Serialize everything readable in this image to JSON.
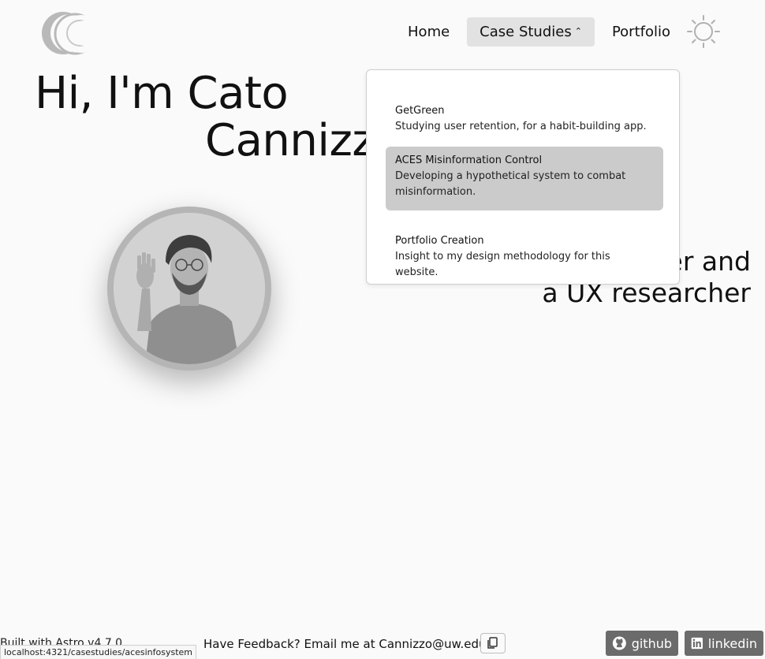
{
  "nav": {
    "home": "Home",
    "case_studies": "Case Studies",
    "case_studies_caret": "^",
    "portfolio": "Portfolio"
  },
  "hero": {
    "line1": "Hi, I'm Cato",
    "line2": "Cannizz",
    "tagline_line1": "er and",
    "tagline_line2": "a UX researcher"
  },
  "dropdown": {
    "items": [
      {
        "title": "GetGreen",
        "description": "Studying user retention, for a habit-building app."
      },
      {
        "title": "ACES Misinformation Control",
        "description": "Developing a hypothetical system to combat misinformation."
      },
      {
        "title": "Portfolio Creation",
        "description": "Insight to my design methodology for this website."
      }
    ]
  },
  "footer": {
    "built_with": "Built with Astro v4.7.0",
    "feedback": "Have Feedback? Email me at Cannizzo@uw.edu",
    "github": "github",
    "linkedin": "linkedin"
  },
  "status_bar": {
    "url": "localhost:4321/casestudies/acesinfosystem"
  },
  "colors": {
    "background": "#fafafa",
    "nav_active": "#e2e2e2",
    "dropdown_hover": "#cbcbcb",
    "social_button": "#6b6b6b"
  },
  "icons": {
    "logo": "crescent-logo-icon",
    "theme": "sun-icon",
    "copy": "copy-icon",
    "github": "github-icon",
    "linkedin": "linkedin-icon"
  }
}
